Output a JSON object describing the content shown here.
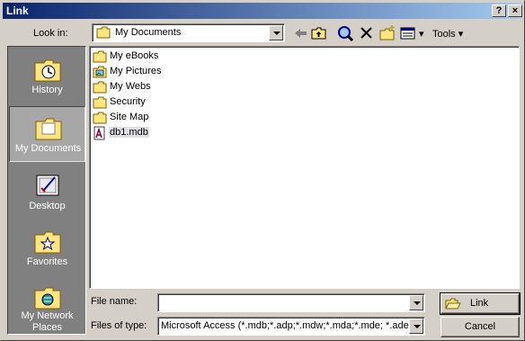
{
  "dialog": {
    "title": "Link",
    "help_glyph": "?",
    "close_glyph": "×"
  },
  "toolbar": {
    "look_in_label": "Look in:",
    "look_in_value": "My Documents",
    "tools_label": "Tools",
    "tools_arrow": "▾",
    "views_arrow": "▾"
  },
  "places": [
    {
      "label": "History"
    },
    {
      "label": "My Documents"
    },
    {
      "label": "Desktop"
    },
    {
      "label": "Favorites"
    },
    {
      "label": "My Network Places"
    }
  ],
  "files": [
    {
      "name": "My eBooks",
      "icon": "folder-icon"
    },
    {
      "name": "My Pictures",
      "icon": "pictures-folder-icon"
    },
    {
      "name": "My Webs",
      "icon": "folder-icon"
    },
    {
      "name": "Security",
      "icon": "folder-icon"
    },
    {
      "name": "Site Map",
      "icon": "folder-icon"
    },
    {
      "name": "db1.mdb",
      "icon": "access-database-icon"
    }
  ],
  "form": {
    "file_name_label": "File name:",
    "file_name_value": "",
    "files_of_type_label": "Files of type:",
    "files_of_type_value": "Microsoft Access (*.mdb;*.adp;*.mdw;*.mda;*.mde; *.ade)"
  },
  "buttons": {
    "link": "Link",
    "cancel": "Cancel"
  }
}
